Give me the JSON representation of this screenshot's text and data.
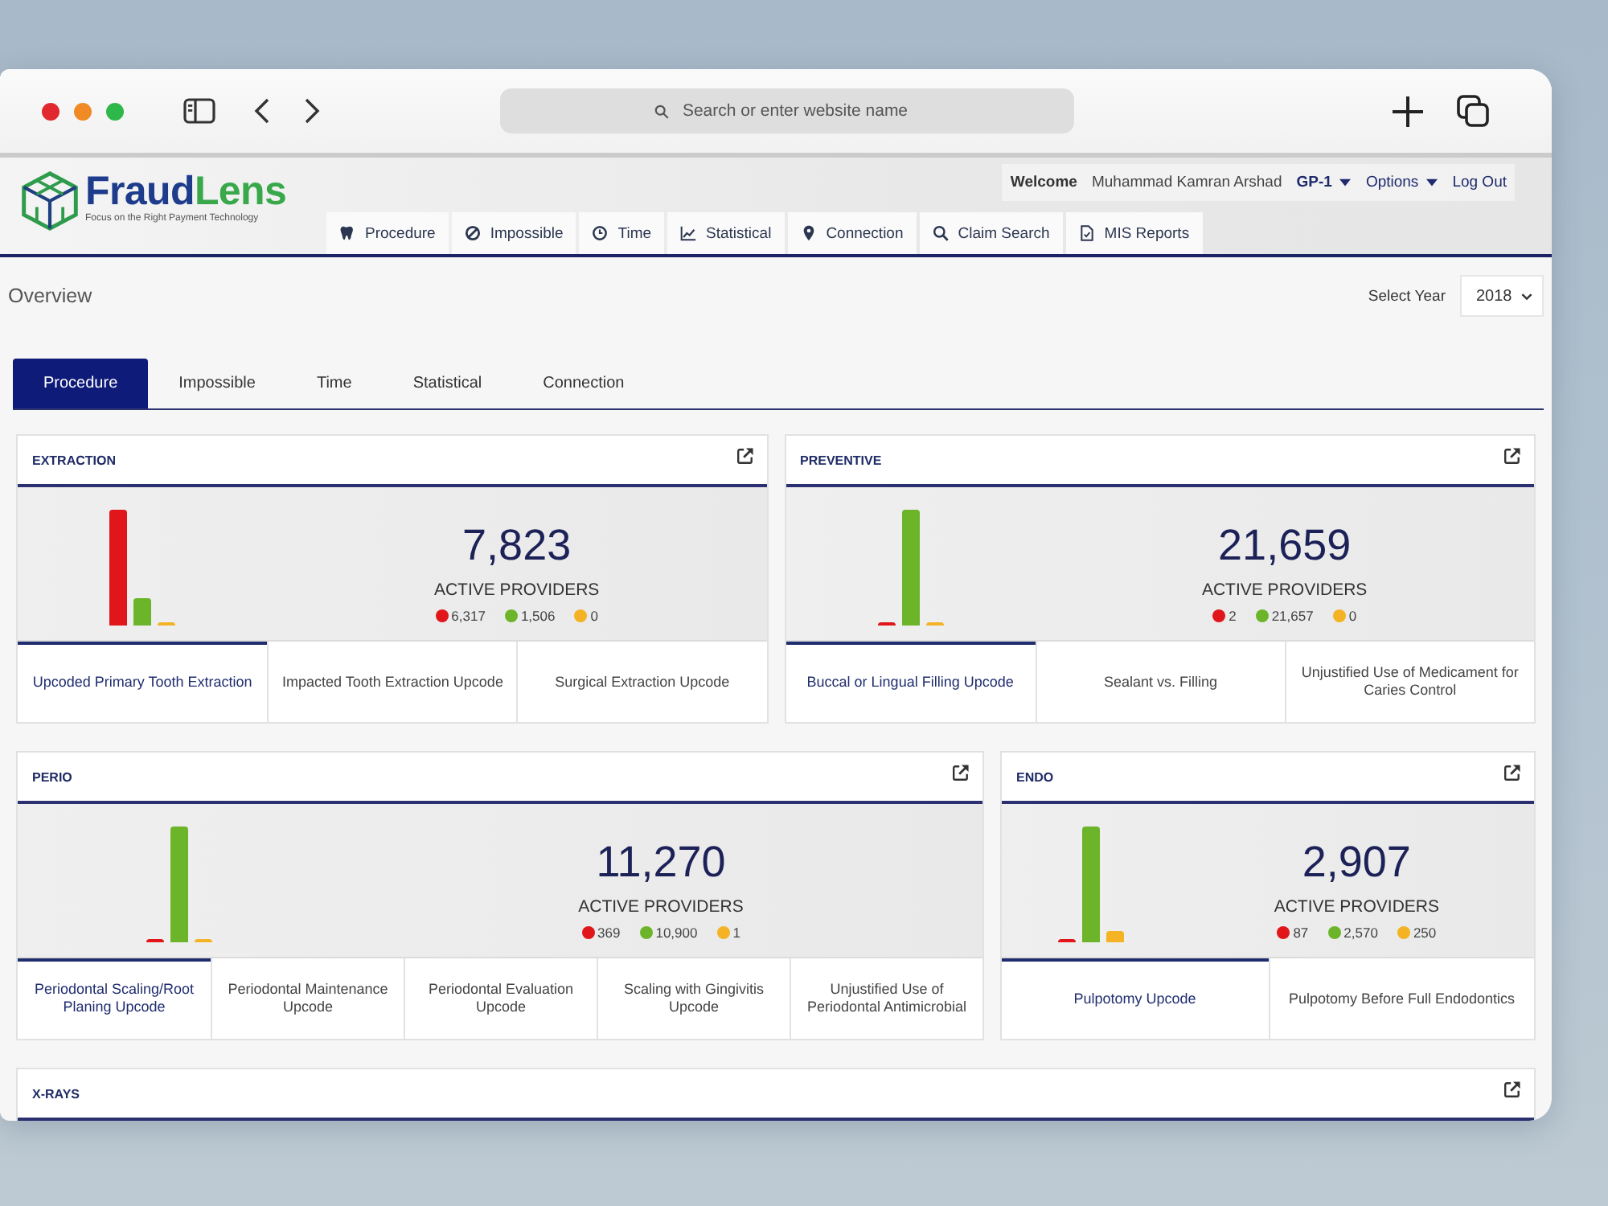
{
  "browser": {
    "address_placeholder": "Search or enter website name"
  },
  "header": {
    "brand": {
      "name": [
        "Fraud",
        "Lens"
      ],
      "tagline": "Focus on the Right Payment Technology"
    },
    "user_bar": {
      "welcome": "Welcome",
      "user_name": "Muhammad Kamran Arshad",
      "group": "GP-1",
      "options": "Options",
      "logout": "Log Out"
    },
    "nav": [
      {
        "label": "Procedure"
      },
      {
        "label": "Impossible"
      },
      {
        "label": "Time"
      },
      {
        "label": "Statistical"
      },
      {
        "label": "Connection"
      },
      {
        "label": "Claim Search"
      },
      {
        "label": "MIS Reports"
      }
    ]
  },
  "page": {
    "title": "Overview",
    "year_select": {
      "label": "Select Year",
      "value": "2018"
    }
  },
  "tabs": [
    {
      "label": "Procedure",
      "selected": true
    },
    {
      "label": "Impossible",
      "selected": false
    },
    {
      "label": "Time",
      "selected": false
    },
    {
      "label": "Statistical",
      "selected": false
    },
    {
      "label": "Connection",
      "selected": false
    }
  ],
  "card_rows": [
    {
      "cards": [
        {
          "title": "EXTRACTION",
          "total": "7,823",
          "total_label": "ACTIVE PROVIDERS",
          "legend": [
            {
              "color": "#e0161b",
              "value": "6,317"
            },
            {
              "color": "#6cb52a",
              "value": "1,506"
            },
            {
              "color": "#f3b324",
              "value": "0"
            }
          ],
          "subtabs": [
            {
              "label": "Upcoded Primary Tooth Extraction",
              "selected": true
            },
            {
              "label": "Impacted Tooth Extraction Upcode",
              "selected": false
            },
            {
              "label": "Surgical Extraction Upcode",
              "selected": false
            }
          ]
        },
        {
          "title": "PREVENTIVE",
          "total": "21,659",
          "total_label": "ACTIVE PROVIDERS",
          "legend": [
            {
              "color": "#e0161b",
              "value": "2"
            },
            {
              "color": "#6cb52a",
              "value": "21,657"
            },
            {
              "color": "#f3b324",
              "value": "0"
            }
          ],
          "subtabs": [
            {
              "label": "Buccal or Lingual Filling Upcode",
              "selected": true
            },
            {
              "label": "Sealant vs. Filling",
              "selected": false
            },
            {
              "label": "Unjustified Use of Medicament for Caries Control",
              "selected": false
            }
          ]
        }
      ]
    },
    {
      "cards": [
        {
          "title": "PERIO",
          "total": "11,270",
          "total_label": "ACTIVE PROVIDERS",
          "legend": [
            {
              "color": "#e0161b",
              "value": "369"
            },
            {
              "color": "#6cb52a",
              "value": "10,900"
            },
            {
              "color": "#f3b324",
              "value": "1"
            }
          ],
          "subtabs": [
            {
              "label": "Periodontal Scaling/Root Planing Upcode",
              "selected": true
            },
            {
              "label": "Periodontal Maintenance Upcode",
              "selected": false
            },
            {
              "label": "Periodontal Evaluation Upcode",
              "selected": false
            },
            {
              "label": "Scaling with Gingivitis Upcode",
              "selected": false
            },
            {
              "label": "Unjustified Use of Periodontal Antimicrobial",
              "selected": false
            }
          ]
        },
        {
          "title": "ENDO",
          "total": "2,907",
          "total_label": "ACTIVE PROVIDERS",
          "legend": [
            {
              "color": "#e0161b",
              "value": "87"
            },
            {
              "color": "#6cb52a",
              "value": "2,570"
            },
            {
              "color": "#f3b324",
              "value": "250"
            }
          ],
          "subtabs": [
            {
              "label": "Pulpotomy Upcode",
              "selected": true
            },
            {
              "label": "Pulpotomy Before Full Endodontics",
              "selected": false
            }
          ]
        }
      ]
    },
    {
      "cards": [
        {
          "title": "X-RAYS"
        }
      ]
    }
  ]
}
